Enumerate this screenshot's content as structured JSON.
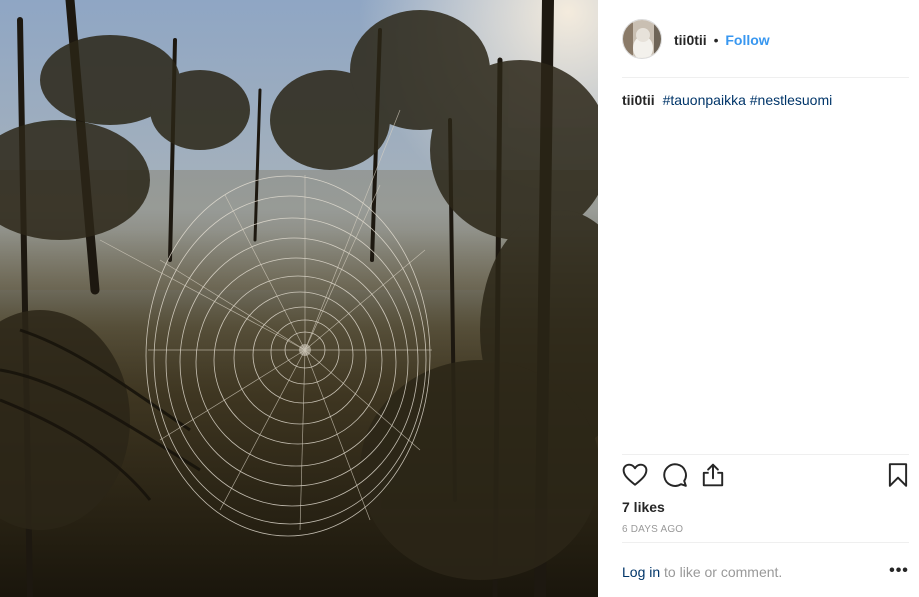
{
  "post": {
    "username": "tii0tii",
    "separator": "•",
    "follow_label": "Follow",
    "caption_username": "tii0tii",
    "hashtags": [
      "#tauonpaikka",
      "#nestlesuomi"
    ],
    "likes_text": "7 likes",
    "time_text": "6 DAYS AGO",
    "login_link": "Log in",
    "login_suffix": " to like or comment.",
    "more_label": "•••"
  },
  "icons": {
    "like": "heart-icon",
    "comment": "comment-icon",
    "share": "share-icon",
    "save": "bookmark-icon",
    "more": "more-options-icon"
  },
  "colors": {
    "link_blue": "#3897f0",
    "hashtag": "#003569",
    "muted": "#999999",
    "text": "#262626",
    "divider": "#efefef"
  }
}
